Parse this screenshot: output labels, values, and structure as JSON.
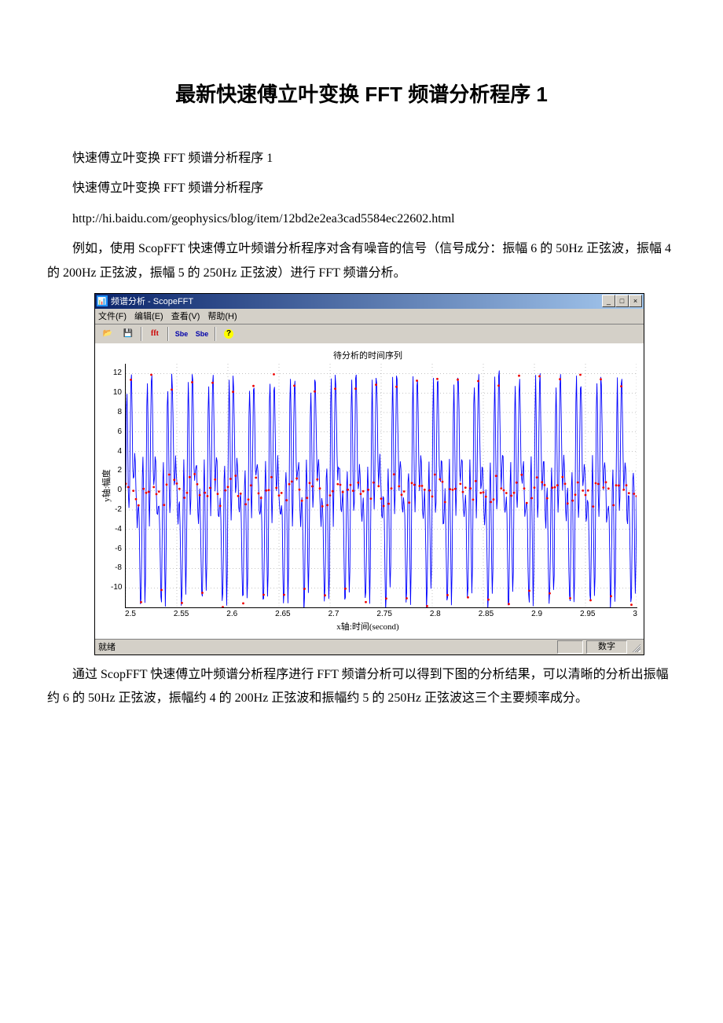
{
  "title": "最新快速傅立叶变换 FFT 频谱分析程序 1",
  "para1": "快速傅立叶变换 FFT 频谱分析程序 1",
  "para2": "快速傅立叶变换 FFT 频谱分析程序",
  "url": "http://hi.baidu.com/geophysics/blog/item/12bd2e2ea3cad5584ec22602.html",
  "para3": "例如，使用 ScopFFT 快速傅立叶频谱分析程序对含有噪音的信号（信号成分：振幅 6 的 50Hz 正弦波，振幅 4 的 200Hz 正弦波，振幅 5 的 250Hz 正弦波）进行 FFT 频谱分析。",
  "para4": "通过 ScopFFT 快速傅立叶频谱分析程序进行 FFT 频谱分析可以得到下图的分析结果，可以清晰的分析出振幅约 6 的 50Hz 正弦波，振幅约 4 的 200Hz 正弦波和振幅约 5 的 250Hz 正弦波这三个主要频率成分。",
  "app": {
    "title": "频谱分析 - ScopeFFT",
    "title_icon": "📊",
    "menus": [
      "文件(F)",
      "编辑(E)",
      "查看(V)",
      "帮助(H)"
    ],
    "toolbar": {
      "open": "📂",
      "save": "💾",
      "fft": "fft",
      "sbe1": "Sbe",
      "sbe2": "Sbe",
      "help": "?"
    },
    "status_left": "就绪",
    "status_right": "数字"
  },
  "chart_data": {
    "type": "line",
    "title": "待分析的时间序列",
    "xlabel": "x轴:时间(second)",
    "ylabel": "y轴:幅度",
    "xlim": [
      2.5,
      3.0
    ],
    "ylim": [
      -12,
      13
    ],
    "x_ticks": [
      "2.5",
      "2.55",
      "2.6",
      "2.65",
      "2.7",
      "2.75",
      "2.8",
      "2.85",
      "2.9",
      "2.95",
      "3"
    ],
    "y_ticks": [
      "12",
      "10",
      "8",
      "6",
      "4",
      "2",
      "0",
      "-2",
      "-4",
      "-6",
      "-8",
      "-10"
    ],
    "signal_components": [
      {
        "amplitude": 6,
        "frequency_hz": 50
      },
      {
        "amplitude": 4,
        "frequency_hz": 200
      },
      {
        "amplitude": 5,
        "frequency_hz": 250
      }
    ],
    "noise": true,
    "sample_markers": "red_dots"
  }
}
